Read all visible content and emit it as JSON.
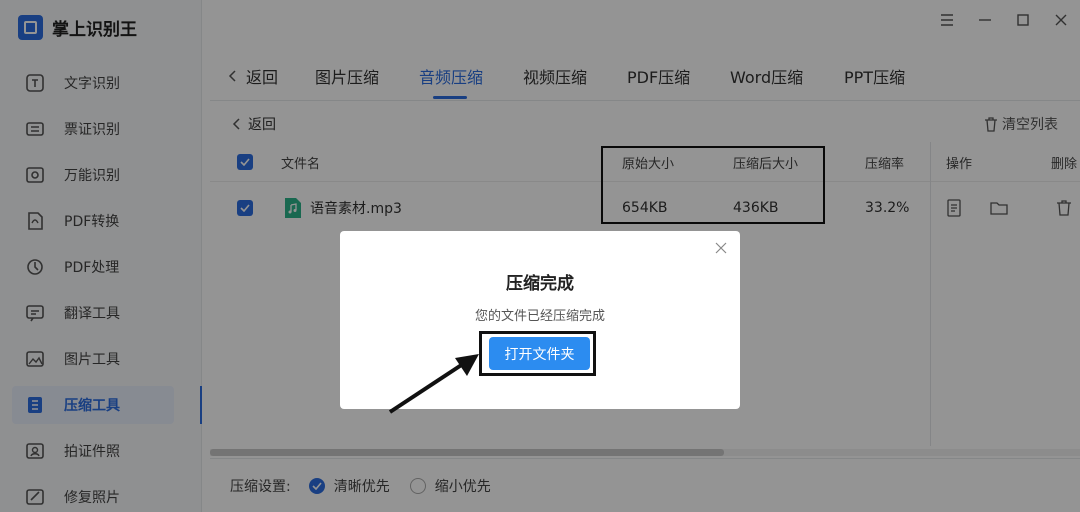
{
  "app": {
    "title": "掌上识别王"
  },
  "sidebar": {
    "items": [
      {
        "label": "文字识别",
        "icon": "text-recognition-icon"
      },
      {
        "label": "票证识别",
        "icon": "ticket-recognition-icon"
      },
      {
        "label": "万能识别",
        "icon": "universal-recognition-icon"
      },
      {
        "label": "PDF转换",
        "icon": "pdf-convert-icon"
      },
      {
        "label": "PDF处理",
        "icon": "pdf-process-icon"
      },
      {
        "label": "翻译工具",
        "icon": "translate-icon"
      },
      {
        "label": "图片工具",
        "icon": "image-tools-icon"
      },
      {
        "label": "压缩工具",
        "icon": "compress-tools-icon",
        "active": true
      },
      {
        "label": "拍证件照",
        "icon": "id-photo-icon"
      },
      {
        "label": "修复照片",
        "icon": "photo-repair-icon"
      }
    ]
  },
  "tabs": {
    "back_label": "返回",
    "items": [
      "图片压缩",
      "音频压缩",
      "视频压缩",
      "PDF压缩",
      "Word压缩",
      "PPT压缩"
    ],
    "active_index": 1
  },
  "content": {
    "back_label": "返回",
    "clear_list_label": "清空列表",
    "columns": {
      "filename": "文件名",
      "original_size": "原始大小",
      "compressed_size": "压缩后大小",
      "ratio": "压缩率",
      "actions": "操作",
      "delete": "删除"
    },
    "rows": [
      {
        "filename": "语音素材.mp3",
        "original_size": "654KB",
        "compressed_size": "436KB",
        "ratio": "33.2%"
      }
    ]
  },
  "footer": {
    "settings_label": "压缩设置:",
    "options": [
      {
        "label": "清晰优先",
        "checked": true
      },
      {
        "label": "缩小优先",
        "checked": false
      }
    ]
  },
  "modal": {
    "title": "压缩完成",
    "message": "您的文件已经压缩完成",
    "button_label": "打开文件夹"
  },
  "colors": {
    "accent": "#2c6de0",
    "button": "#2c8cf0",
    "overlay": "rgba(0,0,0,0.42)"
  }
}
